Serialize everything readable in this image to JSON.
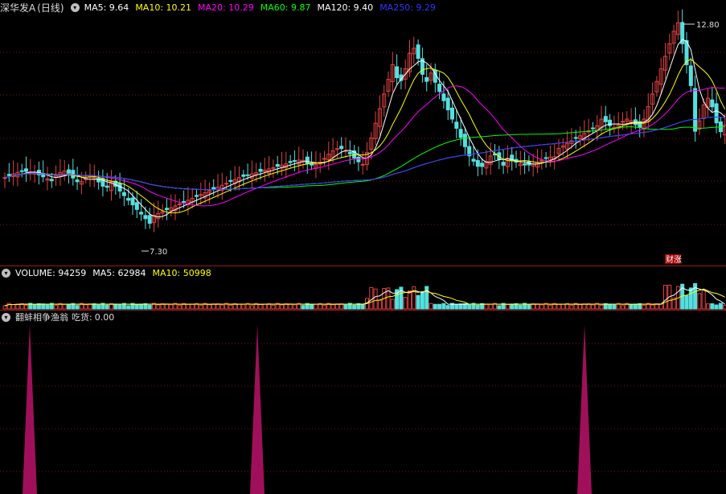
{
  "price_pane": {
    "title": "深华发A",
    "period": "(日线)",
    "indicators": [
      {
        "label": "MA5",
        "value": "9.64",
        "color": "#ffffff"
      },
      {
        "label": "MA10",
        "value": "10.21",
        "color": "#ffff00"
      },
      {
        "label": "MA20",
        "value": "10.29",
        "color": "#ff00ff"
      },
      {
        "label": "MA60",
        "value": "9.87",
        "color": "#00ff00"
      },
      {
        "label": "MA120",
        "value": "9.40",
        "color": "#ffffff"
      },
      {
        "label": "MA250",
        "value": "9.29",
        "color": "#3333ff"
      }
    ],
    "high_label": "12.80",
    "low_label": "7.30",
    "badge": "财",
    "badge2": "涨"
  },
  "volume_pane": {
    "indicators": [
      {
        "label": "VOLUME",
        "value": "94259",
        "color": "#ffffff"
      },
      {
        "label": "MA5",
        "value": "62984",
        "color": "#ffffff"
      },
      {
        "label": "MA10",
        "value": "50998",
        "color": "#ffff00"
      }
    ]
  },
  "signal_pane": {
    "title": "翻蚌相争渔翁",
    "label": "吃货",
    "value": "0.00"
  },
  "colors": {
    "up": "#e04040",
    "down": "#55e0e0",
    "grid": "#7a1010",
    "signal": "#a0105a"
  },
  "icons": [
    "dropdown-circle-icon"
  ]
}
